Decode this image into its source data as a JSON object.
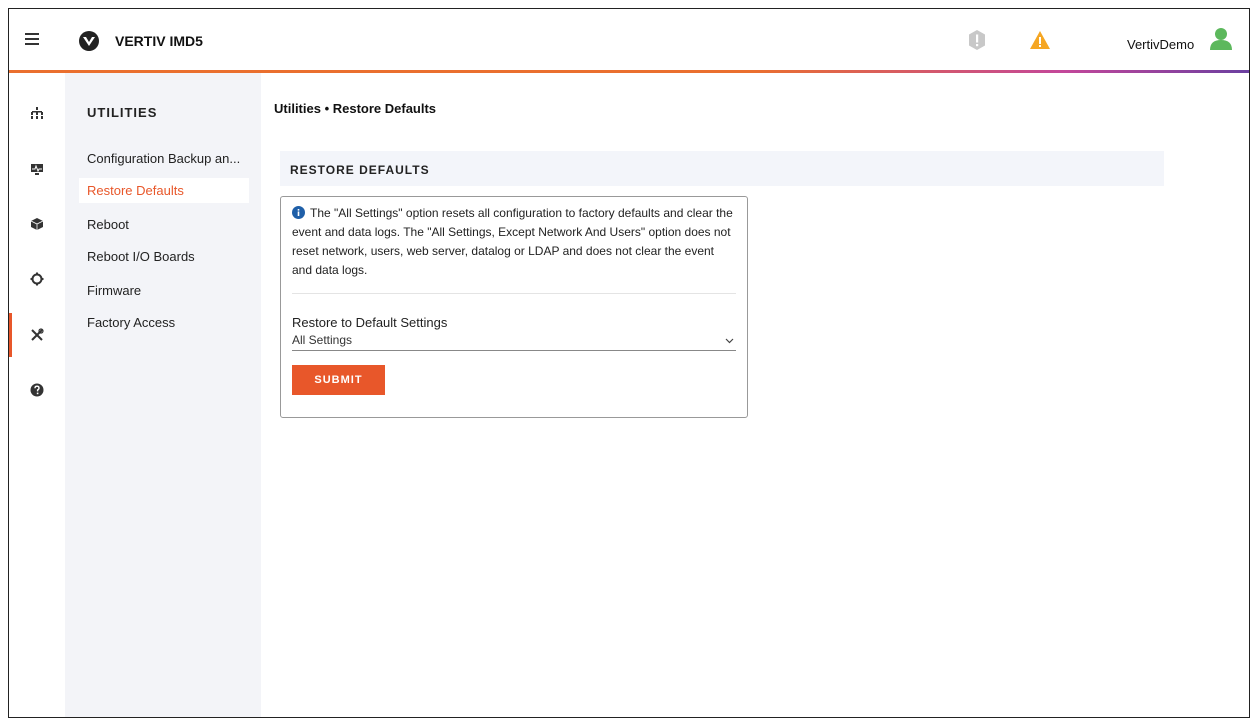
{
  "header": {
    "app_title": "VERTIV IMD5",
    "username": "VertivDemo",
    "icons": [
      "menu-icon",
      "vertiv-logo-icon",
      "alarm-critical-icon",
      "alarm-warning-icon",
      "user-icon"
    ]
  },
  "colors": {
    "accent": "#e8572a",
    "warning": "#f5a623",
    "user": "#5cb85c",
    "sidebar_bg": "#f3f4f8"
  },
  "rail": {
    "items": [
      {
        "icon": "hierarchy-icon"
      },
      {
        "icon": "monitor-icon"
      },
      {
        "icon": "cube-icon"
      },
      {
        "icon": "gear-icon"
      },
      {
        "icon": "tools-icon",
        "active": true
      },
      {
        "icon": "help-icon"
      }
    ]
  },
  "sidebar": {
    "heading": "UTILITIES",
    "items": [
      {
        "label": "Configuration Backup an..."
      },
      {
        "label": "Restore Defaults",
        "active": true
      },
      {
        "label": "Reboot"
      },
      {
        "label": "Reboot I/O Boards"
      },
      {
        "label": "Firmware"
      },
      {
        "label": "Factory Access"
      }
    ]
  },
  "main": {
    "breadcrumb": "Utilities • Restore Defaults",
    "section_title": "RESTORE DEFAULTS",
    "info_text": "The \"All Settings\" option resets all configuration to factory defaults and clear the event and data logs. The \"All Settings, Except Network And Users\" option does not reset network, users, web server, datalog or LDAP and does not clear the event and data logs.",
    "field_label": "Restore to Default Settings",
    "select_value": "All Settings",
    "submit_label": "SUBMIT"
  }
}
